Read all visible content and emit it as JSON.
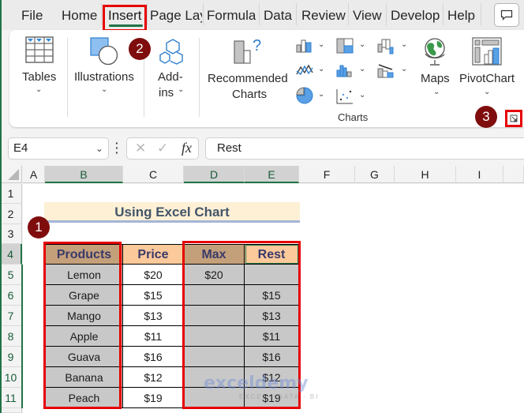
{
  "tabs": [
    {
      "label": "File"
    },
    {
      "label": "Home"
    },
    {
      "label": "Insert",
      "active": true
    },
    {
      "label": "Page Lay"
    },
    {
      "label": "Formula"
    },
    {
      "label": "Data"
    },
    {
      "label": "Review"
    },
    {
      "label": "View"
    },
    {
      "label": "Develop"
    },
    {
      "label": "Help"
    }
  ],
  "ribbon": {
    "tables": "Tables",
    "illustrations": "Illustrations",
    "addins_line1": "Add-",
    "addins_line2": "ins",
    "recommended_line1": "Recommended",
    "recommended_line2": "Charts",
    "maps": "Maps",
    "pivotchart": "PivotChart",
    "charts_group": "Charts",
    "chevron": "⌄"
  },
  "badges": {
    "one": "1",
    "two": "2",
    "three": "3"
  },
  "formula_bar": {
    "name_box": "E4",
    "formula": "Rest",
    "cancel_icon": "✕",
    "enter_icon": "✓",
    "fx": "fx"
  },
  "columns": [
    "A",
    "B",
    "C",
    "D",
    "E",
    "F",
    "G",
    "H",
    "I"
  ],
  "rows": [
    "1",
    "2",
    "3",
    "4",
    "5",
    "6",
    "7",
    "8",
    "9",
    "10",
    "11"
  ],
  "sheet": {
    "title": "Using Excel Chart",
    "headers": [
      "Products",
      "Price",
      "Max",
      "Rest"
    ],
    "table": [
      {
        "product": "Lemon",
        "price": "$20",
        "max": "$20",
        "rest": ""
      },
      {
        "product": "Grape",
        "price": "$15",
        "max": "",
        "rest": "$15"
      },
      {
        "product": "Mango",
        "price": "$13",
        "max": "",
        "rest": "$13"
      },
      {
        "product": "Apple",
        "price": "$11",
        "max": "",
        "rest": "$11"
      },
      {
        "product": "Guava",
        "price": "$16",
        "max": "",
        "rest": "$16"
      },
      {
        "product": "Banana",
        "price": "$12",
        "max": "",
        "rest": "$12"
      },
      {
        "product": "Peach",
        "price": "$19",
        "max": "",
        "rest": "$19"
      }
    ]
  },
  "watermark": {
    "name": "exceldemy",
    "tagline": "EXCEL · DATA · BI"
  },
  "colors": {
    "excel_green": "#217346",
    "highlight_red": "#e60000",
    "badge_maroon": "#7f0d0d",
    "header_tan": "#c4a07a",
    "header_peach": "#fbc99a",
    "cell_gray": "#c8c8c8",
    "title_fill": "#fdf0d5"
  }
}
